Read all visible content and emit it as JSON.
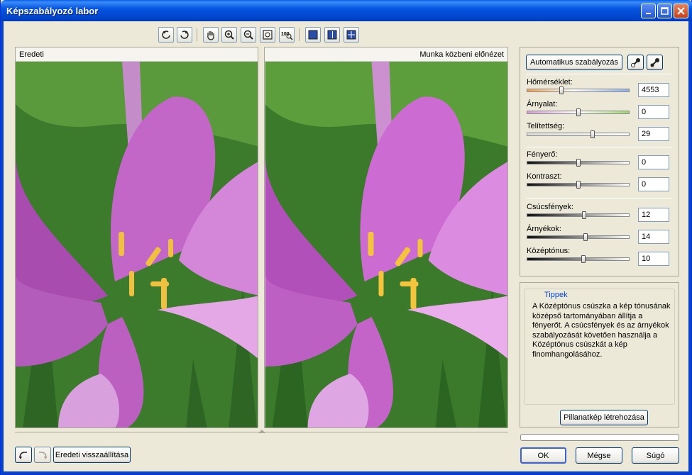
{
  "window": {
    "title": "Képszabályozó labor"
  },
  "toolbar": {
    "zoom_100_label": "100"
  },
  "panels": {
    "original_caption": "Eredeti",
    "preview_caption": "Munka közbeni előnézet"
  },
  "adjust": {
    "auto_button": "Automatikus szabályozás",
    "temperature": {
      "label": "Hőmérséklet:",
      "value": "4553",
      "position": 0.34
    },
    "tint": {
      "label": "Árnyalat:",
      "value": "0",
      "position": 0.5
    },
    "saturation": {
      "label": "Telítettség:",
      "value": "29",
      "position": 0.64
    },
    "brightness": {
      "label": "Fényerő:",
      "value": "0",
      "position": 0.5
    },
    "contrast": {
      "label": "Kontraszt:",
      "value": "0",
      "position": 0.5
    },
    "highlights": {
      "label": "Csúcsfények:",
      "value": "12",
      "position": 0.56
    },
    "shadows": {
      "label": "Árnyékok:",
      "value": "14",
      "position": 0.57
    },
    "midtones": {
      "label": "Középtónus:",
      "value": "10",
      "position": 0.55
    }
  },
  "tips": {
    "title": "Tippek",
    "text": "A Középtónus csúszka a kép tónusának középső tartományában állítja a fényerőt. A csúcsfények és az árnyékok szabályozását követően használja a Középtónus csúszkát a kép finomhangolásához.",
    "snapshot_button": "Pillanatkép létrehozása"
  },
  "footer": {
    "reset_button": "Eredeti visszaállítása",
    "ok_button": "OK",
    "cancel_button": "Mégse",
    "help_button": "Súgó"
  },
  "colors": {
    "petal": "#c266c8",
    "petal_light": "#e4a8e6",
    "grass": "#3c7a2c",
    "stamen": "#f0c040",
    "titlebar": "#0055e5"
  }
}
